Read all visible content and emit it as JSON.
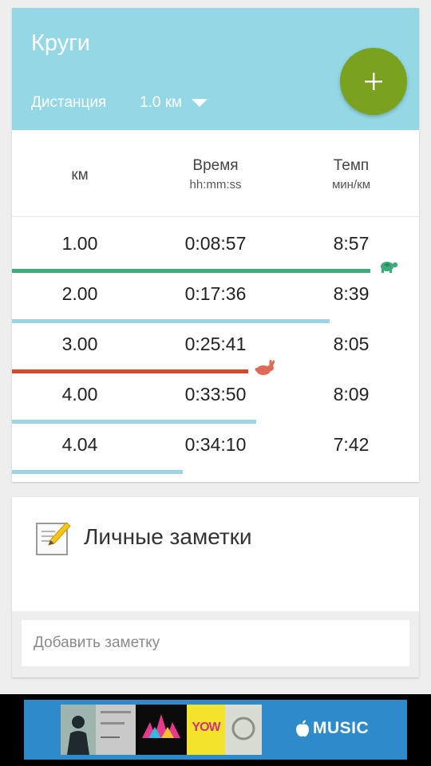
{
  "laps": {
    "title": "Круги",
    "distance_label": "Дистанция",
    "distance_value": "1.0 км",
    "columns": {
      "km": "км",
      "time": "Время",
      "time_unit": "hh:mm:ss",
      "pace": "Темп",
      "pace_unit": "мин/км"
    },
    "rows": [
      {
        "km": "1.00",
        "time": "0:08:57",
        "pace": "8:57",
        "marker": "slowest"
      },
      {
        "km": "2.00",
        "time": "0:17:36",
        "pace": "8:39",
        "marker": ""
      },
      {
        "km": "3.00",
        "time": "0:25:41",
        "pace": "8:05",
        "marker": "fastest"
      },
      {
        "km": "4.00",
        "time": "0:33:50",
        "pace": "8:09",
        "marker": ""
      },
      {
        "km": "4.04",
        "time": "0:34:10",
        "pace": "7:42",
        "marker": ""
      }
    ],
    "bar_fraction": [
      0.88,
      0.78,
      0.58,
      0.6,
      0.42
    ]
  },
  "notes": {
    "title": "Личные заметки",
    "placeholder": "Добавить заметку"
  },
  "ad": {
    "brand": "MUSIC",
    "tile_text": "YOW"
  },
  "colors": {
    "header": "#94d8e6",
    "fab": "#7aa21e",
    "bar_default": "#9dd4e4",
    "bar_slowest": "#3cac78",
    "bar_fastest": "#d44a2c",
    "ad_background": "#2e8ac8"
  },
  "icons": {
    "add": "plus-icon",
    "dropdown": "chevron-down-icon",
    "slowest": "turtle-icon",
    "fastest": "rabbit-icon",
    "notes": "note-pencil-icon",
    "ad_brand": "apple-icon"
  }
}
